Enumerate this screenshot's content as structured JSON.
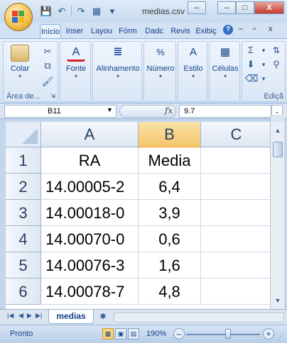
{
  "window": {
    "title": "medias.csv",
    "minimize": "–",
    "restore": "□",
    "close": "X",
    "extra": "⇔"
  },
  "quick_access": {
    "save": "💾",
    "undo": "↶",
    "redo": "↷",
    "customize": "▾"
  },
  "ribbon_tabs": [
    "Início",
    "Inser",
    "Layou",
    "Fórm",
    "Dadc",
    "Revis",
    "Exibiç"
  ],
  "ribbon_window_controls": [
    "–",
    "▫",
    "x"
  ],
  "ribbon": {
    "paste_label": "Colar",
    "clipboard_label": "Área de...",
    "font_label": "Fonte",
    "alignment_label": "Alinhamento",
    "number_label": "Número",
    "style_label": "Estilo",
    "cells_label": "Células",
    "editing_label": "Ediçã"
  },
  "formula_bar": {
    "name_box": "B11",
    "fx": "fx",
    "value": "9.7"
  },
  "sheet": {
    "columns": [
      "A",
      "B",
      "C"
    ],
    "selected_column": "B",
    "rows": [
      {
        "row": "1",
        "a": "RA",
        "b": "Media"
      },
      {
        "row": "2",
        "a": "14.00005-2",
        "b": "6,4"
      },
      {
        "row": "3",
        "a": "14.00018-0",
        "b": "3,9"
      },
      {
        "row": "4",
        "a": "14.00070-0",
        "b": "0,6"
      },
      {
        "row": "5",
        "a": "14.00076-3",
        "b": "1,6"
      },
      {
        "row": "6",
        "a": "14.00078-7",
        "b": "4,8"
      }
    ]
  },
  "sheet_tabs": {
    "active": "medias"
  },
  "status": {
    "text": "Pronto",
    "zoom": "190%",
    "zoom_level": 0.57
  },
  "colors": {
    "accent": "#15428b",
    "selected_header": "#f4c567"
  }
}
